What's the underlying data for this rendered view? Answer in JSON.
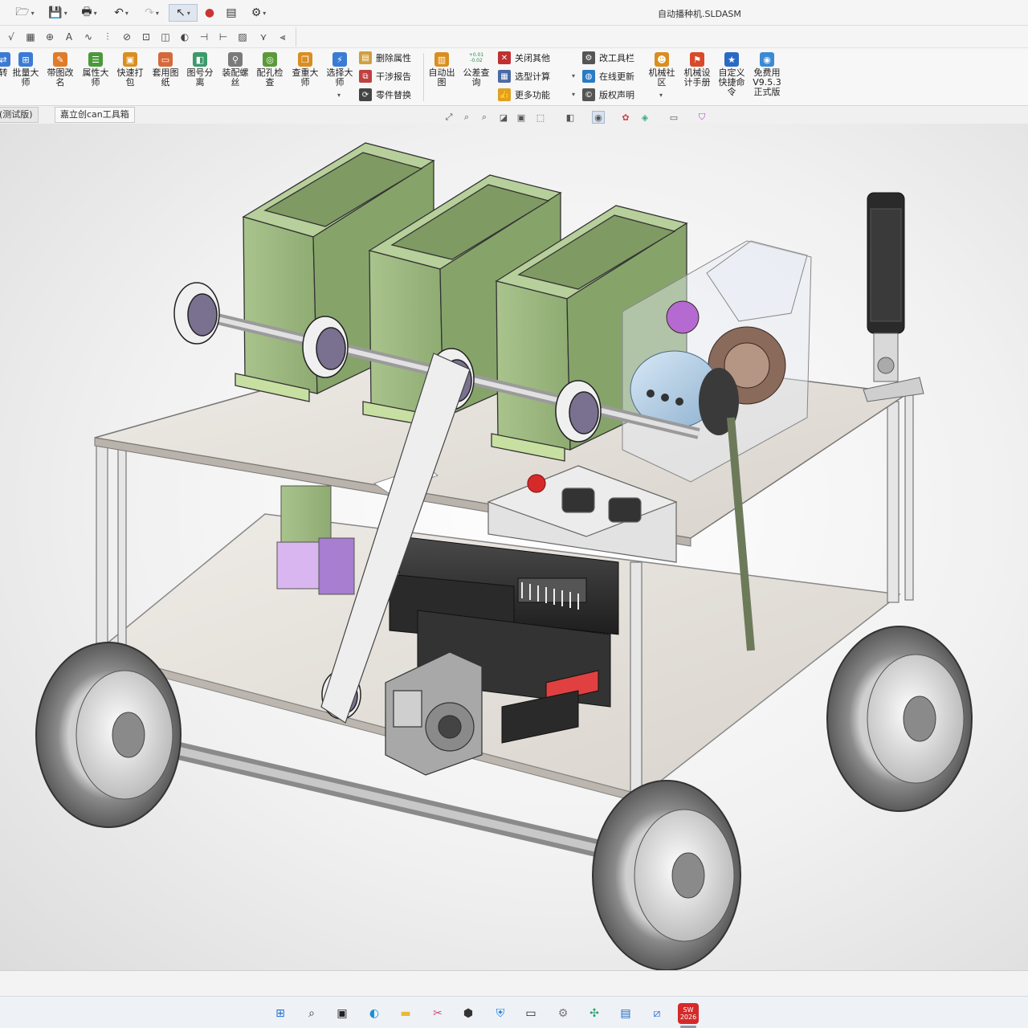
{
  "window": {
    "title": "自动播种机.SLDASM"
  },
  "quick_access": [
    {
      "icon": "open-file-icon"
    },
    {
      "icon": "save-icon"
    },
    {
      "icon": "print-icon"
    },
    {
      "icon": "undo-icon"
    },
    {
      "icon": "redo-icon"
    },
    {
      "icon": "select-cursor-icon"
    },
    {
      "icon": "traffic-light-icon"
    },
    {
      "icon": "file-properties-icon"
    },
    {
      "icon": "options-gear-icon"
    }
  ],
  "ribbon": {
    "large_buttons_left": [
      {
        "label": "转",
        "color": "#3b7bd4"
      },
      {
        "label": "批量大\n师",
        "color": "#3b7bd4"
      },
      {
        "label": "带图改\n名",
        "color": "#e07b2a"
      },
      {
        "label": "属性大\n师",
        "color": "#4a9a3a"
      },
      {
        "label": "快速打\n包",
        "color": "#d98e1f"
      },
      {
        "label": "套用图\n纸",
        "color": "#d46a3b"
      },
      {
        "label": "图号分\n离",
        "color": "#3b9a6a"
      },
      {
        "label": "装配螺\n丝",
        "color": "#7a7a7a"
      },
      {
        "label": "配孔检\n查",
        "color": "#5a9a3a"
      },
      {
        "label": "查重大\n师",
        "color": "#d98e1f"
      },
      {
        "label": "选择大\n师",
        "color": "#3b7bd4"
      }
    ],
    "small_group_1": [
      {
        "label": "删除属性",
        "color": "#d0a040"
      },
      {
        "label": "干涉报告",
        "color": "#c04040"
      },
      {
        "label": "零件替换",
        "color": "#444"
      }
    ],
    "large_buttons_mid": [
      {
        "label": "自动出\n图",
        "color": "#d98e1f"
      },
      {
        "label": "公差查\n询",
        "badge": "+0.01\n-0.02",
        "color": "#2a8a4a"
      }
    ],
    "small_group_2": [
      {
        "label": "关闭其他",
        "color": "#c03030"
      },
      {
        "label": "选型计算",
        "color": "#4a6aa4"
      },
      {
        "label": "更多功能",
        "color": "#e0a020"
      }
    ],
    "small_group_3": [
      {
        "label": "改工具栏",
        "color": "#555"
      },
      {
        "label": "在线更新",
        "color": "#2a7ac4"
      },
      {
        "label": "版权声明",
        "color": "#555"
      }
    ],
    "large_buttons_right": [
      {
        "label": "机械社\n区",
        "color": "#d98e1f"
      },
      {
        "label": "机械设\n计手册",
        "color": "#d94a2a"
      },
      {
        "label": "自定义\n快捷命\n令",
        "color": "#2a6ac4"
      },
      {
        "label": "免费用\nV9.5.3\n正式版",
        "color": "#3a8ad4"
      }
    ]
  },
  "tabs": [
    {
      "label": "(测试版)"
    },
    {
      "label": "嘉立创can工具箱"
    }
  ],
  "model": {
    "name": "自动播种机"
  },
  "taskbar": [
    {
      "icon": "windows-start-icon",
      "color": "#1f6fd6"
    },
    {
      "icon": "search-icon",
      "color": "#333"
    },
    {
      "icon": "task-view-icon",
      "color": "#222"
    },
    {
      "icon": "edge-browser-icon",
      "color": "#1a8fd8"
    },
    {
      "icon": "file-explorer-icon",
      "color": "#e8b83a"
    },
    {
      "icon": "snipping-tool-icon",
      "color": "#d04a8a"
    },
    {
      "icon": "3d-box-icon",
      "color": "#333"
    },
    {
      "icon": "security-shield-icon",
      "color": "#1a7ad8"
    },
    {
      "icon": "terminal-icon",
      "color": "#222"
    },
    {
      "icon": "settings-gear-icon",
      "color": "#777"
    },
    {
      "icon": "clover-app-icon",
      "color": "#2aa06a"
    },
    {
      "icon": "store-icon",
      "color": "#1a6ac4"
    },
    {
      "icon": "visual-studio-icon",
      "color": "#2a6ad4"
    },
    {
      "icon": "solidworks-icon",
      "label": "SW\n2026",
      "color": "#d42a2a"
    }
  ]
}
